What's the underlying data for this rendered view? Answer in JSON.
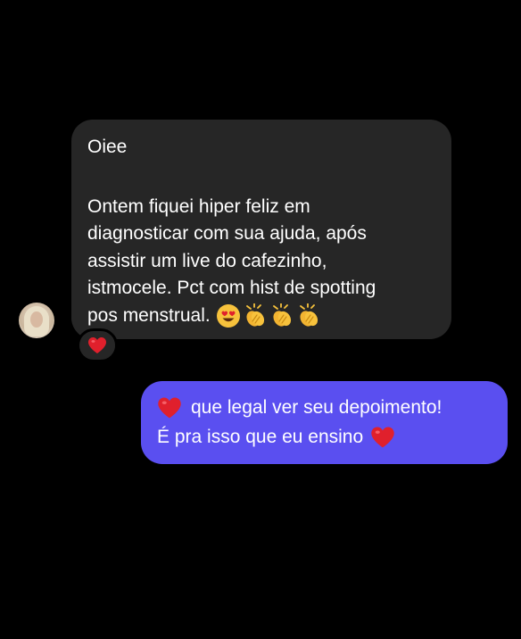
{
  "conversation": {
    "incoming": {
      "greeting": "Oiee",
      "lines": [
        "Ontem fiquei hiper feliz em",
        "diagnosticar com sua ajuda, após",
        "assistir um live do cafezinho,",
        "istmocele. Pct com hist de spotting",
        "pos menstrual."
      ],
      "emojis": [
        "heart-eyes-icon",
        "clapping-hands-icon",
        "clapping-hands-icon",
        "clapping-hands-icon"
      ],
      "reaction": "heart-icon"
    },
    "outgoing": {
      "line1": "que legal ver seu depoimento!",
      "line2": "É pra isso que eu ensino"
    }
  },
  "colors": {
    "background": "#000000",
    "incoming_bubble": "#262626",
    "outgoing_bubble": "#5a4ff0",
    "text": "#ffffff",
    "heart": "#e0202c"
  }
}
